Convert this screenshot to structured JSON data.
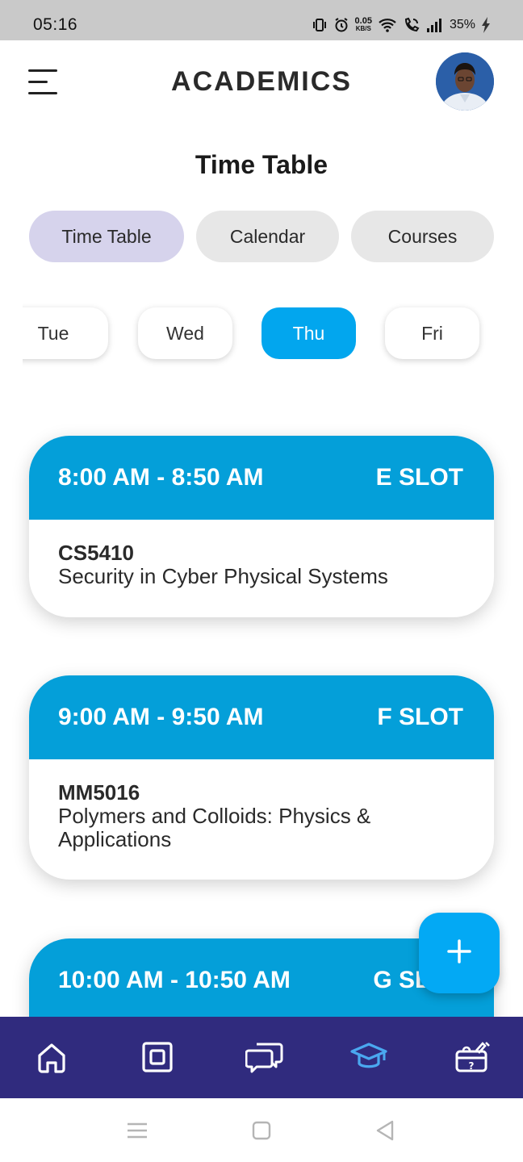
{
  "status_bar": {
    "time": "05:16",
    "net_speed_value": "0.05",
    "net_speed_unit": "KB/S",
    "battery": "35%"
  },
  "header": {
    "title": "ACADEMICS",
    "menu_icon": "hamburger-menu-icon",
    "avatar": "profile-avatar"
  },
  "page_title": "Time Table",
  "tabs": [
    {
      "label": "Time Table",
      "active": true
    },
    {
      "label": "Calendar",
      "active": false
    },
    {
      "label": "Courses",
      "active": false
    }
  ],
  "days": [
    {
      "label": "Tue",
      "active": false
    },
    {
      "label": "Wed",
      "active": false
    },
    {
      "label": "Thu",
      "active": true
    },
    {
      "label": "Fri",
      "active": false
    }
  ],
  "slots": [
    {
      "time": "8:00 AM - 8:50 AM",
      "slot": "E SLOT",
      "code": "CS5410",
      "name": "Security in Cyber Physical Systems"
    },
    {
      "time": "9:00 AM - 9:50 AM",
      "slot": "F SLOT",
      "code": "MM5016",
      "name": "Polymers and Colloids: Physics & Applications"
    },
    {
      "time": "10:00 AM - 10:50 AM",
      "slot": "G SLOT",
      "code": "",
      "name": ""
    }
  ],
  "fab": {
    "icon": "plus-icon"
  },
  "bottom_nav": [
    {
      "icon": "home-icon",
      "active": false
    },
    {
      "icon": "square-icon",
      "active": false
    },
    {
      "icon": "chat-icon",
      "active": false
    },
    {
      "icon": "graduation-cap-icon",
      "active": true
    },
    {
      "icon": "help-box-icon",
      "active": false
    }
  ],
  "colors": {
    "accent": "#02a6ee",
    "slot_header": "#049fd9",
    "nav_bg": "#302b7e",
    "nav_active": "#4aa8f0",
    "tab_active": "#d6d3ec",
    "tab_inactive": "#e7e7e7"
  }
}
